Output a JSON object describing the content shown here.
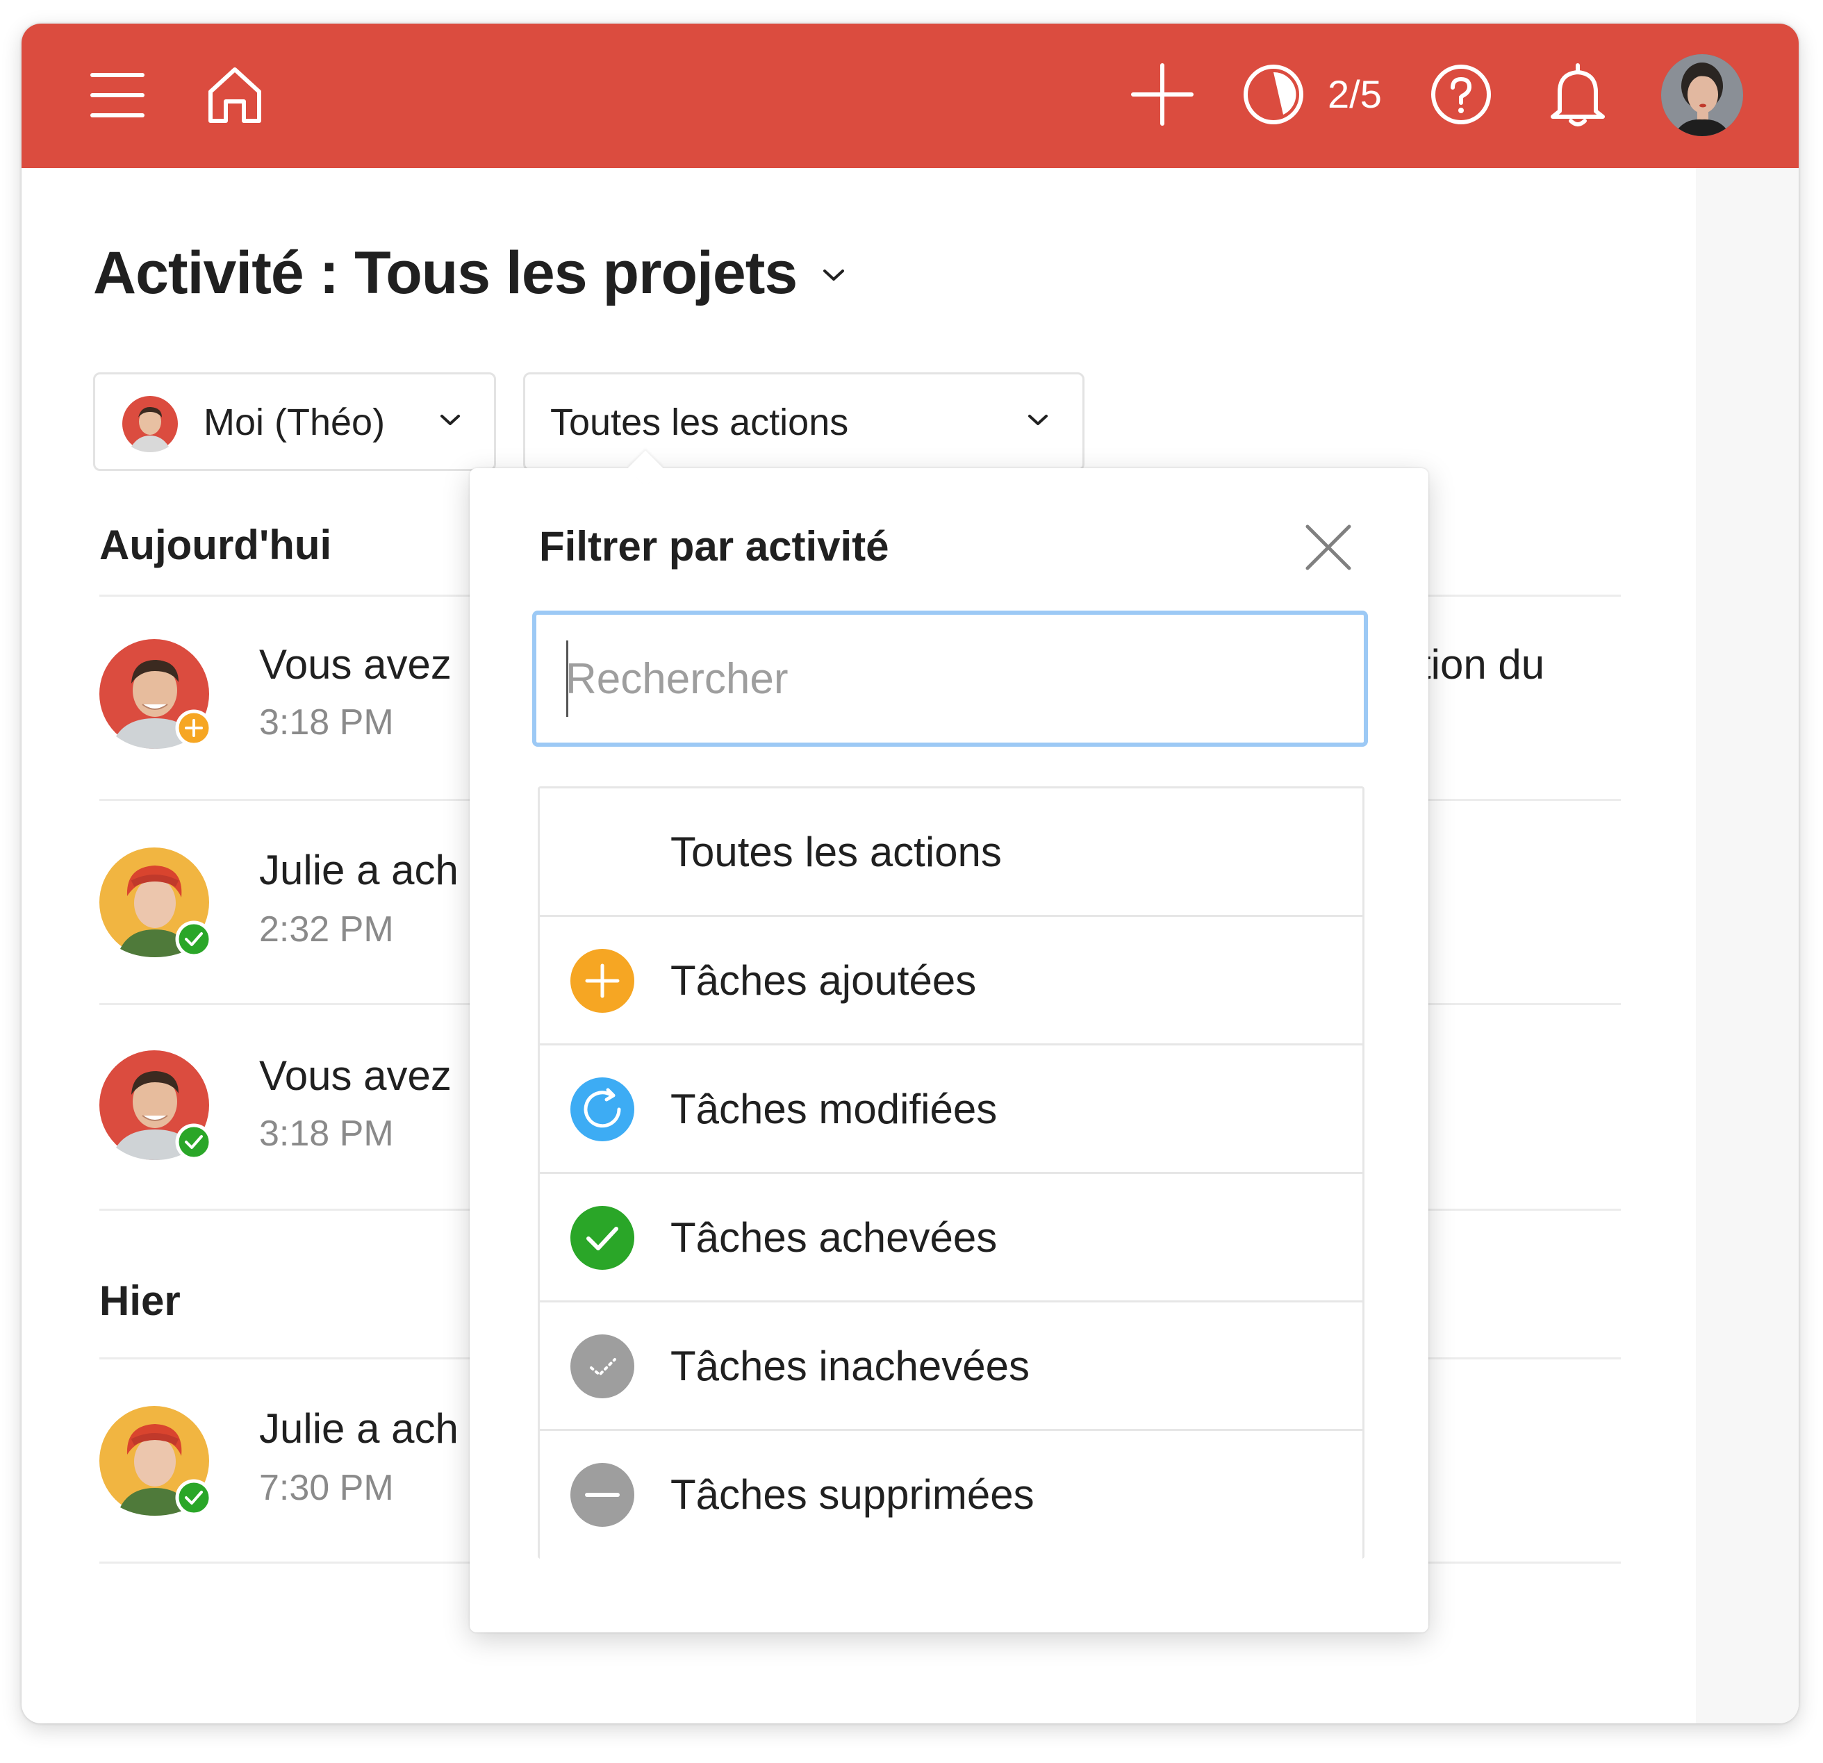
{
  "header": {
    "karma": "2/5",
    "brand_color": "#db4c3f",
    "icons": [
      "menu-icon",
      "home-icon",
      "plus-icon",
      "karma-pie-icon",
      "help-icon",
      "bell-icon"
    ]
  },
  "page": {
    "title": "Activité : Tous les projets"
  },
  "filters": {
    "user": "Moi (Théo)",
    "action": "Toutes les actions"
  },
  "sections": {
    "today": "Aujourd'hui",
    "yesterday": "Hier"
  },
  "activities": [
    {
      "text": "Vous avez",
      "time": "3:18 PM",
      "trailing": "tion du",
      "badge": "added"
    },
    {
      "text": "Julie a ach",
      "time": "2:32 PM",
      "trailing": "",
      "badge": "completed"
    },
    {
      "text": "Vous avez",
      "time": "3:18 PM",
      "trailing": "",
      "badge": "completed"
    },
    {
      "text": "Julie a ach",
      "time": "7:30 PM",
      "trailing": "",
      "badge": "completed"
    }
  ],
  "popover": {
    "title": "Filtrer par activité",
    "search_placeholder": "Rechercher",
    "options": [
      {
        "label": "Toutes les actions",
        "icon": "none"
      },
      {
        "label": "Tâches ajoutées",
        "icon": "added-icon",
        "color": "#f6a623"
      },
      {
        "label": "Tâches modifiées",
        "icon": "updated-icon",
        "color": "#3dacf4"
      },
      {
        "label": "Tâches achevées",
        "icon": "completed-icon",
        "color": "#2aa628"
      },
      {
        "label": "Tâches inachevées",
        "icon": "uncompleted-icon",
        "color": "#9e9e9e"
      },
      {
        "label": "Tâches supprimées",
        "icon": "deleted-icon",
        "color": "#9e9e9e"
      }
    ]
  }
}
